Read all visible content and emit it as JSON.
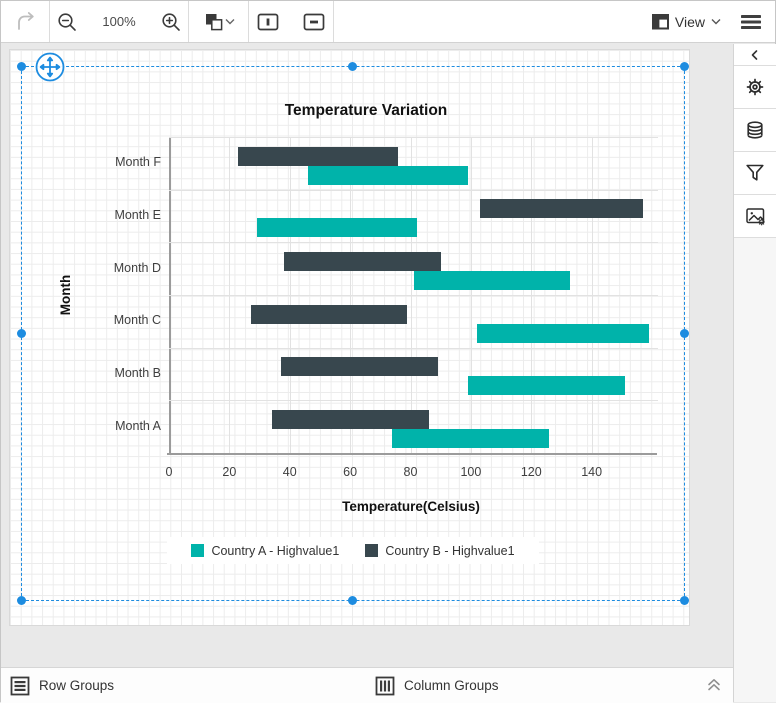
{
  "toolbar": {
    "zoom_level": "100%",
    "view_label": "View"
  },
  "colors": {
    "selection_blue": "#1d8ce0",
    "series_a_teal": "#00b3aa",
    "series_b_dark": "#38474e"
  },
  "chart_data": {
    "type": "bar",
    "variant": "range-bar-horizontal",
    "title": "Temperature Variation",
    "xlabel": "Temperature(Celsius)",
    "ylabel": "Month",
    "categories": [
      "Month F",
      "Month E",
      "Month D",
      "Month C",
      "Month B",
      "Month A"
    ],
    "categories_order": "top-to-bottom",
    "x_ticks": [
      0,
      20,
      40,
      60,
      80,
      100,
      120,
      140
    ],
    "xlim": [
      0,
      160
    ],
    "grid": true,
    "legend_position": "bottom-center",
    "series": [
      {
        "name": "Country A - Highvalue1",
        "color": "#00b3aa",
        "row_position": "lower",
        "ranges": [
          [
            46,
            99
          ],
          [
            29,
            82
          ],
          [
            81,
            133
          ],
          [
            102,
            159
          ],
          [
            99,
            151
          ],
          [
            74,
            126
          ]
        ]
      },
      {
        "name": "Country B - Highvalue1",
        "color": "#38474e",
        "row_position": "upper",
        "ranges": [
          [
            23,
            76
          ],
          [
            103,
            157
          ],
          [
            38,
            90
          ],
          [
            27,
            79
          ],
          [
            37,
            89
          ],
          [
            34,
            86
          ]
        ]
      }
    ]
  },
  "bottom_bar": {
    "row_groups_label": "Row Groups",
    "column_groups_label": "Column Groups"
  }
}
